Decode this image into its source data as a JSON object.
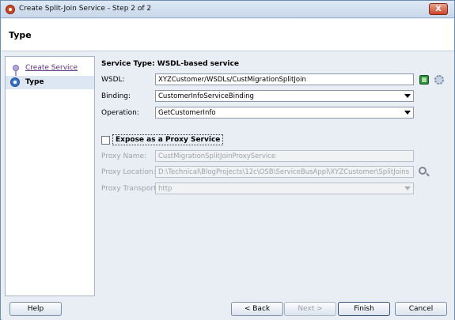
{
  "window": {
    "title": "Create Split-Join Service - Step 2 of 2",
    "close_label": "X"
  },
  "header": {
    "title": "Type"
  },
  "nav": {
    "steps": [
      {
        "label": "Create Service",
        "state": "done"
      },
      {
        "label": "Type",
        "state": "current"
      }
    ]
  },
  "content": {
    "service_type": "Service Type: WSDL-based service",
    "wsdl": {
      "label": "WSDL:",
      "value": "XYZCustomer/WSDLs/CustMigrationSplitJoin"
    },
    "binding": {
      "label": "Binding:",
      "value": "CustomerInfoServiceBinding"
    },
    "operation": {
      "label": "Operation:",
      "value": "GetCustomerInfo"
    },
    "expose_proxy": {
      "label": "Expose as a Proxy Service",
      "checked": false
    },
    "proxy_name": {
      "label": "Proxy Name:",
      "value": "CustMigrationSplitJoinProxyService"
    },
    "proxy_location": {
      "label": "Proxy Location:",
      "value": "D:\\Technical\\BlogProjects\\12c\\OSB\\ServiceBusAppl\\XYZCustomer\\SplitJoins"
    },
    "proxy_transport": {
      "label": "Proxy Transport:",
      "value": "http"
    }
  },
  "footer": {
    "help": "Help",
    "back": "< Back",
    "next": "Next >",
    "finish": "Finish",
    "cancel": "Cancel"
  },
  "colors": {
    "accent": "#3b7ed0",
    "link": "#5a2d82"
  }
}
